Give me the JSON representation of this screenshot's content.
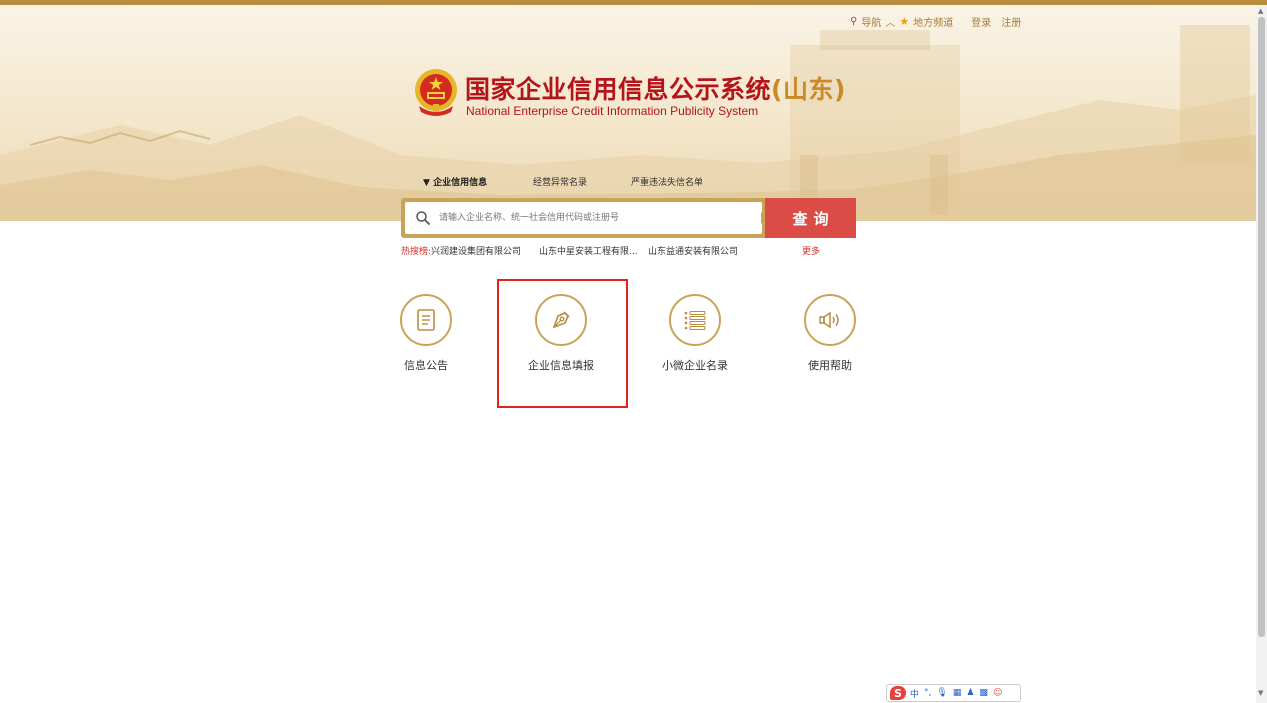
{
  "topnav": {
    "nav_label": "导航",
    "local_channel": "地方频道",
    "login": "登录",
    "register": "注册"
  },
  "header": {
    "title_cn": "国家企业信用信息公示系统",
    "title_province": "(山东)",
    "title_en": "National Enterprise Credit Information Publicity System"
  },
  "search": {
    "tabs": [
      "企业信用信息",
      "经营异常名录",
      "严重违法失信名单"
    ],
    "active_tab_marker": "▼",
    "placeholder": "请输入企业名称、统一社会信用代码或注册号",
    "button_label": "查询"
  },
  "hot_search": {
    "label": "热搜榜:",
    "items": [
      "兴润建设集团有限公司",
      "山东中星安装工程有限...",
      "山东益通安装有限公司"
    ],
    "more": "更多"
  },
  "features": [
    {
      "label": "信息公告",
      "icon": "document-icon"
    },
    {
      "label": "企业信息填报",
      "icon": "pen-nib-icon"
    },
    {
      "label": "小微企业名录",
      "icon": "list-icon"
    },
    {
      "label": "使用帮助",
      "icon": "speaker-icon"
    }
  ],
  "ime": {
    "logo": "S",
    "mode": "中",
    "items": [
      "°,",
      "mic",
      "keyboard",
      "shirt",
      "grid",
      "face"
    ]
  },
  "colors": {
    "accent_gold": "#c9a458",
    "brand_red": "#b4141a",
    "button_red": "#dc4c46",
    "highlight_red": "#e2231a"
  }
}
